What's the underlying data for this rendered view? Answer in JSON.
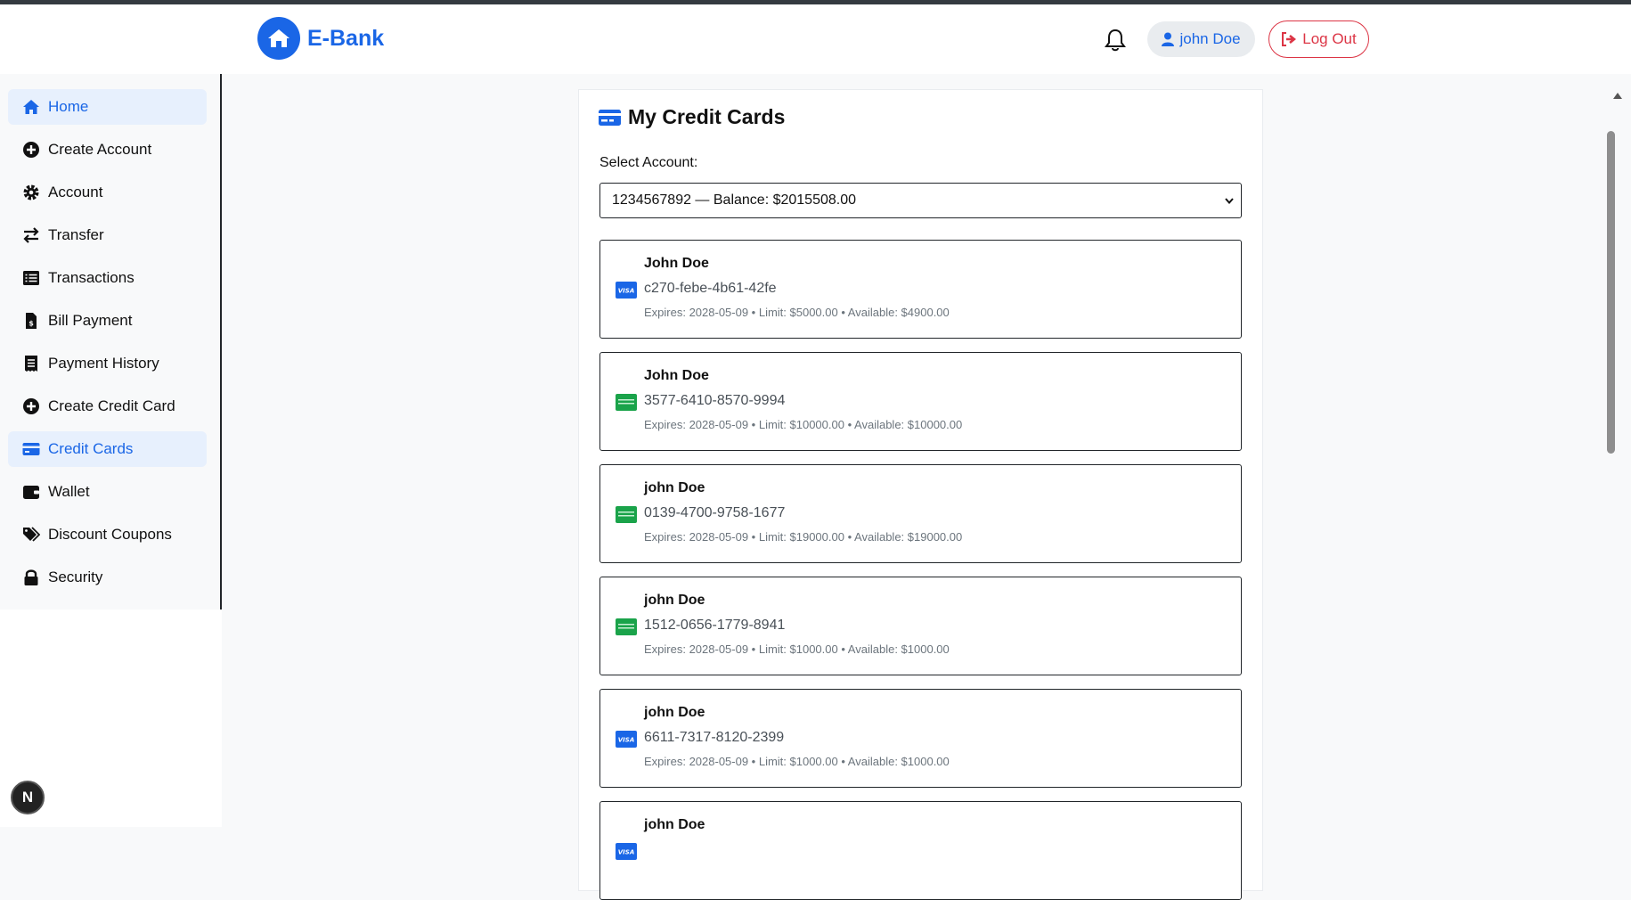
{
  "header": {
    "brand": "E-Bank",
    "user_label": "john Doe",
    "logout_label": "Log Out"
  },
  "sidebar": {
    "items": [
      {
        "label": "Home",
        "icon": "home-icon",
        "active": true
      },
      {
        "label": "Create Account",
        "icon": "plus-circle-icon",
        "active": false
      },
      {
        "label": "Account",
        "icon": "gear-icon",
        "active": false
      },
      {
        "label": "Transfer",
        "icon": "transfer-arrows-icon",
        "active": false
      },
      {
        "label": "Transactions",
        "icon": "list-icon",
        "active": false
      },
      {
        "label": "Bill Payment",
        "icon": "invoice-dollar-icon",
        "active": false
      },
      {
        "label": "Payment History",
        "icon": "receipt-icon",
        "active": false
      },
      {
        "label": "Create Credit Card",
        "icon": "plus-circle-icon",
        "active": false
      },
      {
        "label": "Credit Cards",
        "icon": "credit-card-icon",
        "active": true
      },
      {
        "label": "Wallet",
        "icon": "wallet-icon",
        "active": false
      },
      {
        "label": "Discount Coupons",
        "icon": "tags-icon",
        "active": false
      },
      {
        "label": "Security",
        "icon": "lock-icon",
        "active": false
      }
    ]
  },
  "main": {
    "title": "My Credit Cards",
    "select_label": "Select Account:",
    "selected_account": "1234567892 — Balance: $2015508.00",
    "cards": [
      {
        "name": "John Doe",
        "number": "c270-febe-4b61-42fe",
        "details": "Expires: 2028-05-09 • Limit: $5000.00 • Available: $4900.00",
        "brand": "visa"
      },
      {
        "name": "John Doe",
        "number": "3577-6410-8570-9994",
        "details": "Expires: 2028-05-09 • Limit: $10000.00 • Available: $10000.00",
        "brand": "generic-green"
      },
      {
        "name": "john Doe",
        "number": "0139-4700-9758-1677",
        "details": "Expires: 2028-05-09 • Limit: $19000.00 • Available: $19000.00",
        "brand": "generic-green"
      },
      {
        "name": "john Doe",
        "number": "1512-0656-1779-8941",
        "details": "Expires: 2028-05-09 • Limit: $1000.00 • Available: $1000.00",
        "brand": "generic-green"
      },
      {
        "name": "john Doe",
        "number": "6611-7317-8120-2399",
        "details": "Expires: 2028-05-09 • Limit: $1000.00 • Available: $1000.00",
        "brand": "visa"
      },
      {
        "name": "john Doe",
        "number": "",
        "details": "",
        "brand": "visa"
      }
    ]
  },
  "colors": {
    "accent": "#1a66e6",
    "danger": "#dc3545",
    "visa": "#1a66e6",
    "generic_card": "#1aa34a"
  },
  "badge": "N"
}
